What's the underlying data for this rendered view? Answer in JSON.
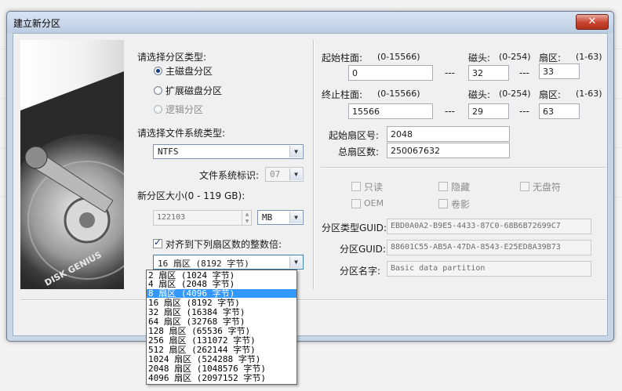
{
  "window": {
    "title": "建立新分区",
    "close_icon": "close-x"
  },
  "image_panel": {
    "brand_text": "DISK GENIUS"
  },
  "partition_type": {
    "label": "请选择分区类型:",
    "options": [
      {
        "label": "主磁盘分区",
        "checked": true,
        "enabled": true
      },
      {
        "label": "扩展磁盘分区",
        "checked": false,
        "enabled": true
      },
      {
        "label": "逻辑分区",
        "checked": false,
        "enabled": false
      }
    ]
  },
  "filesystem": {
    "label": "请选择文件系统类型:",
    "value": "NTFS",
    "id_label": "文件系统标识:",
    "id_value": "07"
  },
  "size": {
    "label": "新分区大小(0 - 119 GB):",
    "value": "122103",
    "unit": "MB"
  },
  "align": {
    "label": "对齐到下列扇区数的整数倍:",
    "checked": true,
    "value": "16 扇区 (8192 字节)"
  },
  "align_options": [
    "2 扇区 (1024 字节)",
    "4 扇区 (2048 字节)",
    "8 扇区 (4096 字节)",
    "16 扇区 (8192 字节)",
    "32 扇区 (16384 字节)",
    "64 扇区 (32768 字节)",
    "128 扇区 (65536 字节)",
    "256 扇区 (131072 字节)",
    "512 扇区 (262144 字节)",
    "1024 扇区 (524288 字节)",
    "2048 扇区 (1048576 字节)",
    "4096 扇区 (2097152 字节)"
  ],
  "align_selected_index": 2,
  "chs": {
    "start_cyl_label": "起始柱面:",
    "start_cyl_range": "(0-15566)",
    "start_cyl": "0",
    "end_cyl_label": "终止柱面:",
    "end_cyl_range": "(0-15566)",
    "end_cyl": "15566",
    "head_label": "磁头:",
    "head_range": "(0-254)",
    "sector_label": "扇区:",
    "sector_range": "(1-63)",
    "start_head": "32",
    "start_sector": "33",
    "end_head": "29",
    "end_sector": "63",
    "dash": "---"
  },
  "lba": {
    "start_label": "起始扇区号:",
    "start": "2048",
    "total_label": "总扇区数:",
    "total": "250067632"
  },
  "attributes": {
    "readonly": "只读",
    "hidden": "隐藏",
    "no_letter": "无盘符",
    "oem": "OEM",
    "shadow": "卷影"
  },
  "guid": {
    "type_label": "分区类型GUID:",
    "type_value": "EBD0A0A2-B9E5-4433-87C0-68B6B72699C7",
    "part_label": "分区GUID:",
    "part_value": "88601C55-AB5A-47DA-8543-E25ED8A39B73",
    "name_label": "分区名字:",
    "name_value": "Basic data partition"
  }
}
